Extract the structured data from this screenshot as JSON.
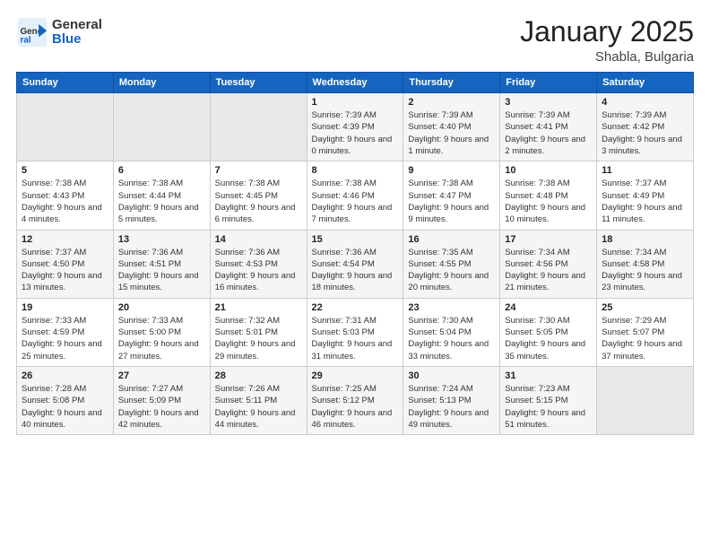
{
  "logo": {
    "general": "General",
    "blue": "Blue"
  },
  "header": {
    "month": "January 2025",
    "location": "Shabla, Bulgaria"
  },
  "weekdays": [
    "Sunday",
    "Monday",
    "Tuesday",
    "Wednesday",
    "Thursday",
    "Friday",
    "Saturday"
  ],
  "weeks": [
    [
      {
        "day": "",
        "sunrise": "",
        "sunset": "",
        "daylight": "",
        "empty": true
      },
      {
        "day": "",
        "sunrise": "",
        "sunset": "",
        "daylight": "",
        "empty": true
      },
      {
        "day": "",
        "sunrise": "",
        "sunset": "",
        "daylight": "",
        "empty": true
      },
      {
        "day": "1",
        "sunrise": "Sunrise: 7:39 AM",
        "sunset": "Sunset: 4:39 PM",
        "daylight": "Daylight: 9 hours and 0 minutes."
      },
      {
        "day": "2",
        "sunrise": "Sunrise: 7:39 AM",
        "sunset": "Sunset: 4:40 PM",
        "daylight": "Daylight: 9 hours and 1 minute."
      },
      {
        "day": "3",
        "sunrise": "Sunrise: 7:39 AM",
        "sunset": "Sunset: 4:41 PM",
        "daylight": "Daylight: 9 hours and 2 minutes."
      },
      {
        "day": "4",
        "sunrise": "Sunrise: 7:39 AM",
        "sunset": "Sunset: 4:42 PM",
        "daylight": "Daylight: 9 hours and 3 minutes."
      }
    ],
    [
      {
        "day": "5",
        "sunrise": "Sunrise: 7:38 AM",
        "sunset": "Sunset: 4:43 PM",
        "daylight": "Daylight: 9 hours and 4 minutes."
      },
      {
        "day": "6",
        "sunrise": "Sunrise: 7:38 AM",
        "sunset": "Sunset: 4:44 PM",
        "daylight": "Daylight: 9 hours and 5 minutes."
      },
      {
        "day": "7",
        "sunrise": "Sunrise: 7:38 AM",
        "sunset": "Sunset: 4:45 PM",
        "daylight": "Daylight: 9 hours and 6 minutes."
      },
      {
        "day": "8",
        "sunrise": "Sunrise: 7:38 AM",
        "sunset": "Sunset: 4:46 PM",
        "daylight": "Daylight: 9 hours and 7 minutes."
      },
      {
        "day": "9",
        "sunrise": "Sunrise: 7:38 AM",
        "sunset": "Sunset: 4:47 PM",
        "daylight": "Daylight: 9 hours and 9 minutes."
      },
      {
        "day": "10",
        "sunrise": "Sunrise: 7:38 AM",
        "sunset": "Sunset: 4:48 PM",
        "daylight": "Daylight: 9 hours and 10 minutes."
      },
      {
        "day": "11",
        "sunrise": "Sunrise: 7:37 AM",
        "sunset": "Sunset: 4:49 PM",
        "daylight": "Daylight: 9 hours and 11 minutes."
      }
    ],
    [
      {
        "day": "12",
        "sunrise": "Sunrise: 7:37 AM",
        "sunset": "Sunset: 4:50 PM",
        "daylight": "Daylight: 9 hours and 13 minutes."
      },
      {
        "day": "13",
        "sunrise": "Sunrise: 7:36 AM",
        "sunset": "Sunset: 4:51 PM",
        "daylight": "Daylight: 9 hours and 15 minutes."
      },
      {
        "day": "14",
        "sunrise": "Sunrise: 7:36 AM",
        "sunset": "Sunset: 4:53 PM",
        "daylight": "Daylight: 9 hours and 16 minutes."
      },
      {
        "day": "15",
        "sunrise": "Sunrise: 7:36 AM",
        "sunset": "Sunset: 4:54 PM",
        "daylight": "Daylight: 9 hours and 18 minutes."
      },
      {
        "day": "16",
        "sunrise": "Sunrise: 7:35 AM",
        "sunset": "Sunset: 4:55 PM",
        "daylight": "Daylight: 9 hours and 20 minutes."
      },
      {
        "day": "17",
        "sunrise": "Sunrise: 7:34 AM",
        "sunset": "Sunset: 4:56 PM",
        "daylight": "Daylight: 9 hours and 21 minutes."
      },
      {
        "day": "18",
        "sunrise": "Sunrise: 7:34 AM",
        "sunset": "Sunset: 4:58 PM",
        "daylight": "Daylight: 9 hours and 23 minutes."
      }
    ],
    [
      {
        "day": "19",
        "sunrise": "Sunrise: 7:33 AM",
        "sunset": "Sunset: 4:59 PM",
        "daylight": "Daylight: 9 hours and 25 minutes."
      },
      {
        "day": "20",
        "sunrise": "Sunrise: 7:33 AM",
        "sunset": "Sunset: 5:00 PM",
        "daylight": "Daylight: 9 hours and 27 minutes."
      },
      {
        "day": "21",
        "sunrise": "Sunrise: 7:32 AM",
        "sunset": "Sunset: 5:01 PM",
        "daylight": "Daylight: 9 hours and 29 minutes."
      },
      {
        "day": "22",
        "sunrise": "Sunrise: 7:31 AM",
        "sunset": "Sunset: 5:03 PM",
        "daylight": "Daylight: 9 hours and 31 minutes."
      },
      {
        "day": "23",
        "sunrise": "Sunrise: 7:30 AM",
        "sunset": "Sunset: 5:04 PM",
        "daylight": "Daylight: 9 hours and 33 minutes."
      },
      {
        "day": "24",
        "sunrise": "Sunrise: 7:30 AM",
        "sunset": "Sunset: 5:05 PM",
        "daylight": "Daylight: 9 hours and 35 minutes."
      },
      {
        "day": "25",
        "sunrise": "Sunrise: 7:29 AM",
        "sunset": "Sunset: 5:07 PM",
        "daylight": "Daylight: 9 hours and 37 minutes."
      }
    ],
    [
      {
        "day": "26",
        "sunrise": "Sunrise: 7:28 AM",
        "sunset": "Sunset: 5:08 PM",
        "daylight": "Daylight: 9 hours and 40 minutes."
      },
      {
        "day": "27",
        "sunrise": "Sunrise: 7:27 AM",
        "sunset": "Sunset: 5:09 PM",
        "daylight": "Daylight: 9 hours and 42 minutes."
      },
      {
        "day": "28",
        "sunrise": "Sunrise: 7:26 AM",
        "sunset": "Sunset: 5:11 PM",
        "daylight": "Daylight: 9 hours and 44 minutes."
      },
      {
        "day": "29",
        "sunrise": "Sunrise: 7:25 AM",
        "sunset": "Sunset: 5:12 PM",
        "daylight": "Daylight: 9 hours and 46 minutes."
      },
      {
        "day": "30",
        "sunrise": "Sunrise: 7:24 AM",
        "sunset": "Sunset: 5:13 PM",
        "daylight": "Daylight: 9 hours and 49 minutes."
      },
      {
        "day": "31",
        "sunrise": "Sunrise: 7:23 AM",
        "sunset": "Sunset: 5:15 PM",
        "daylight": "Daylight: 9 hours and 51 minutes."
      },
      {
        "day": "",
        "sunrise": "",
        "sunset": "",
        "daylight": "",
        "empty": true
      }
    ]
  ]
}
